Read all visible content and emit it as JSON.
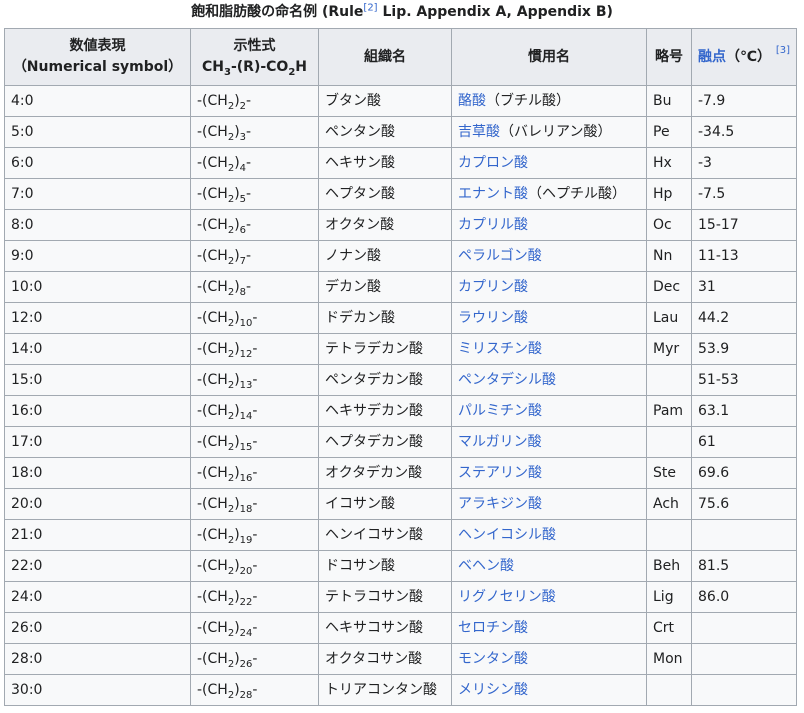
{
  "caption": {
    "prefix": "飽和脂肪酸の命名例 (Rule",
    "ref1": "[2]",
    "suffix": " Lip. Appendix A, Appendix B)"
  },
  "headers": {
    "numerical_line1": "数値表現",
    "numerical_line2": "（Numerical symbol）",
    "formula_label": "示性式",
    "formula_part1": "CH",
    "formula_sub1": "3",
    "formula_part2": "-(R)-CO",
    "formula_sub2": "2",
    "formula_part3": "H",
    "systematic": "組織名",
    "common": "慣用名",
    "abbrev": "略号",
    "mp_link": "融点",
    "mp_unit": "（℃）",
    "mp_ref": "[3]"
  },
  "rows": [
    {
      "num": "4:0",
      "n": "2",
      "sys": "ブタン酸",
      "common_link": "酪酸",
      "common_extra": "（ブチル酸）",
      "abbr": "Bu",
      "mp": "-7.9"
    },
    {
      "num": "5:0",
      "n": "3",
      "sys": "ペンタン酸",
      "common_link": "吉草酸",
      "common_extra": "（バレリアン酸）",
      "abbr": "Pe",
      "mp": "-34.5"
    },
    {
      "num": "6:0",
      "n": "4",
      "sys": "ヘキサン酸",
      "common_link": "カプロン酸",
      "common_extra": "",
      "abbr": "Hx",
      "mp": "-3"
    },
    {
      "num": "7:0",
      "n": "5",
      "sys": "ヘプタン酸",
      "common_link": "エナント酸",
      "common_extra": "（ヘプチル酸）",
      "abbr": "Hp",
      "mp": "-7.5"
    },
    {
      "num": "8:0",
      "n": "6",
      "sys": "オクタン酸",
      "common_link": "カプリル酸",
      "common_extra": "",
      "abbr": "Oc",
      "mp": "15-17"
    },
    {
      "num": "9:0",
      "n": "7",
      "sys": "ノナン酸",
      "common_link": "ペラルゴン酸",
      "common_extra": "",
      "abbr": "Nn",
      "mp": "11-13"
    },
    {
      "num": "10:0",
      "n": "8",
      "sys": "デカン酸",
      "common_link": "カプリン酸",
      "common_extra": "",
      "abbr": "Dec",
      "mp": "31"
    },
    {
      "num": "12:0",
      "n": "10",
      "sys": "ドデカン酸",
      "common_link": "ラウリン酸",
      "common_extra": "",
      "abbr": "Lau",
      "mp": "44.2"
    },
    {
      "num": "14:0",
      "n": "12",
      "sys": "テトラデカン酸",
      "common_link": "ミリスチン酸",
      "common_extra": "",
      "abbr": "Myr",
      "mp": "53.9"
    },
    {
      "num": "15:0",
      "n": "13",
      "sys": "ペンタデカン酸",
      "common_link": "ペンタデシル酸",
      "common_extra": "",
      "abbr": "",
      "mp": "51-53"
    },
    {
      "num": "16:0",
      "n": "14",
      "sys": "ヘキサデカン酸",
      "common_link": "パルミチン酸",
      "common_extra": "",
      "abbr": "Pam",
      "mp": "63.1"
    },
    {
      "num": "17:0",
      "n": "15",
      "sys": "ヘプタデカン酸",
      "common_link": "マルガリン酸",
      "common_extra": "",
      "abbr": "",
      "mp": "61"
    },
    {
      "num": "18:0",
      "n": "16",
      "sys": "オクタデカン酸",
      "common_link": "ステアリン酸",
      "common_extra": "",
      "abbr": "Ste",
      "mp": "69.6"
    },
    {
      "num": "20:0",
      "n": "18",
      "sys": "イコサン酸",
      "common_link": "アラキジン酸",
      "common_extra": "",
      "abbr": "Ach",
      "mp": "75.6"
    },
    {
      "num": "21:0",
      "n": "19",
      "sys": "ヘンイコサン酸",
      "common_link": "ヘンイコシル酸",
      "common_extra": "",
      "abbr": "",
      "mp": ""
    },
    {
      "num": "22:0",
      "n": "20",
      "sys": "ドコサン酸",
      "common_link": "ベヘン酸",
      "common_extra": "",
      "abbr": "Beh",
      "mp": "81.5"
    },
    {
      "num": "24:0",
      "n": "22",
      "sys": "テトラコサン酸",
      "common_link": "リグノセリン酸",
      "common_extra": "",
      "abbr": "Lig",
      "mp": "86.0"
    },
    {
      "num": "26:0",
      "n": "24",
      "sys": "ヘキサコサン酸",
      "common_link": "セロチン酸",
      "common_extra": "",
      "abbr": "Crt",
      "mp": ""
    },
    {
      "num": "28:0",
      "n": "26",
      "sys": "オクタコサン酸",
      "common_link": "モンタン酸",
      "common_extra": "",
      "abbr": "Mon",
      "mp": ""
    },
    {
      "num": "30:0",
      "n": "28",
      "sys": "トリアコンタン酸",
      "common_link": "メリシン酸",
      "common_extra": "",
      "abbr": "",
      "mp": ""
    }
  ],
  "formula_cell": {
    "prefix": "-(CH",
    "sub": "2",
    "close": ")",
    "suffix": "-"
  },
  "colors": {
    "link": "#3366cc",
    "header_bg": "#eaecf0",
    "cell_bg": "#f8f9fa",
    "border": "#a2a9b1",
    "text": "#202122"
  }
}
